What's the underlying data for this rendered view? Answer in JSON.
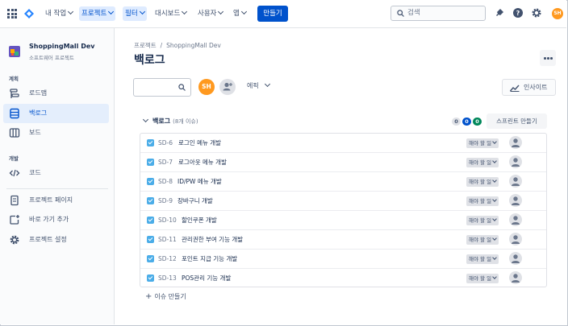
{
  "topnav": {
    "items": [
      {
        "label": "내 작업",
        "active": false
      },
      {
        "label": "프로젝트",
        "active": true
      },
      {
        "label": "필터",
        "active": true
      },
      {
        "label": "대시보드",
        "active": false
      },
      {
        "label": "사용자",
        "active": false
      },
      {
        "label": "앱",
        "active": false
      }
    ],
    "create_label": "만들기",
    "search_placeholder": "검색",
    "avatar_initials": "SH",
    "icons": [
      "app-grid-icon",
      "jira-logo-icon",
      "search-icon",
      "notification-icon",
      "help-icon",
      "settings-icon"
    ]
  },
  "sidebar": {
    "project_name": "ShoppingMall Dev",
    "project_type": "소프트웨어 프로젝트",
    "sections": {
      "planning": "계획",
      "development": "개발"
    },
    "items": [
      {
        "label": "로드맵",
        "icon": "roadmap-icon",
        "active": false
      },
      {
        "label": "백로그",
        "icon": "backlog-icon",
        "active": true
      },
      {
        "label": "보드",
        "icon": "board-icon",
        "active": false
      },
      {
        "label": "코드",
        "icon": "code-icon",
        "active": false
      },
      {
        "label": "프로젝트 페이지",
        "icon": "page-icon",
        "active": false
      },
      {
        "label": "바로 가기 추가",
        "icon": "add-shortcut-icon",
        "active": false
      },
      {
        "label": "프로젝트 설정",
        "icon": "settings-icon",
        "active": false
      }
    ]
  },
  "main": {
    "breadcrumb": [
      "프로젝트",
      "ShoppingMall Dev"
    ],
    "title": "백로그",
    "filter_avatar": "SH",
    "epic_label": "에픽",
    "insights_label": "인사이트",
    "backlog": {
      "title": "백로그",
      "count_label": "(8개 이슈)",
      "counts": [
        "0",
        "0",
        "0"
      ],
      "sprint_button": "스프린트 만들기",
      "issues": [
        {
          "key": "SD-6",
          "summary": "로그인 메뉴 개발",
          "status": "해야 할 일"
        },
        {
          "key": "SD-7",
          "summary": "로그아웃 메뉴 개발",
          "status": "해야 할 일"
        },
        {
          "key": "SD-8",
          "summary": "ID/PW 메뉴 개발",
          "status": "해야 할 일"
        },
        {
          "key": "SD-9",
          "summary": "장바구니 개발",
          "status": "해야 할 일"
        },
        {
          "key": "SD-10",
          "summary": "할인쿠폰 개발",
          "status": "해야 할 일"
        },
        {
          "key": "SD-11",
          "summary": "관리권한 부여 기능 개발",
          "status": "해야 할 일"
        },
        {
          "key": "SD-12",
          "summary": "포인트 지급 기능 개발",
          "status": "해야 할 일"
        },
        {
          "key": "SD-13",
          "summary": "POS관리 기능 개발",
          "status": "해야 할 일"
        }
      ],
      "create_issue_label": "이슈 만들기"
    }
  },
  "colors": {
    "primary": "#0052CC",
    "active_nav_bg": "#DEEBFF",
    "avatar_orange": "#FF991F",
    "issue_type_blue": "#4BADE8",
    "count_done_green": "#00875A"
  }
}
